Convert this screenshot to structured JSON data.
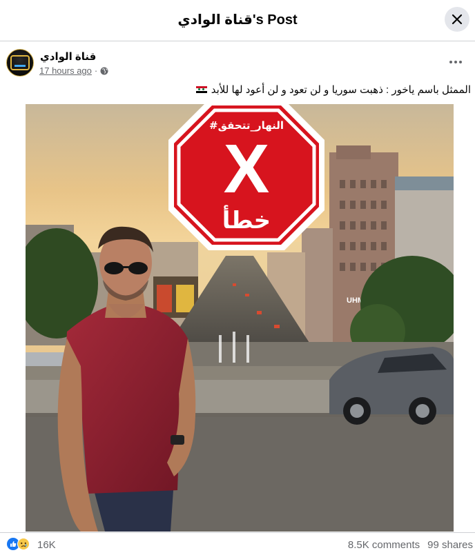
{
  "modal": {
    "title": "قناة الوادي's Post"
  },
  "post": {
    "page_name": "قناة الوادي",
    "time": "17 hours ago",
    "caption": "الممثل باسم ياخور : ذهبت سوريا و لن تعود و لن أعود لها للأبد",
    "caption_flag": "syria-flag-icon",
    "image": {
      "stamp_hashtag": "#النهار_تتحقق",
      "stamp_verdict": "خطأ",
      "stamp_mark": "X",
      "billboard_text": "UHM"
    }
  },
  "engagement": {
    "reaction_count": "16K",
    "comments": "8.5K comments",
    "shares": "99 shares"
  },
  "colors": {
    "stamp_red": "#d7141e",
    "like_blue": "#1877f2",
    "text_secondary": "#65676b"
  }
}
